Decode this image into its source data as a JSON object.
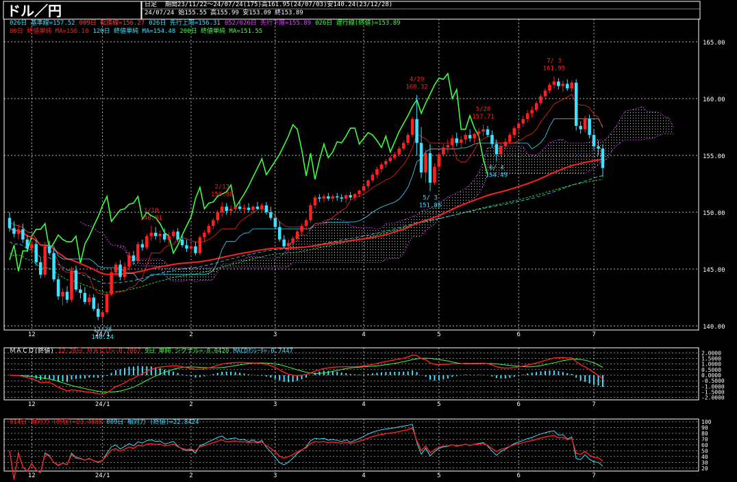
{
  "header": {
    "title": "ドル／円",
    "chart_type_label": "日足",
    "period": "期間23/11/22～24/07/24(175)高161.95(24/07/03)安140.24(23/12/28)",
    "date": "24/07/24",
    "ohlc": "始155.55 高155.99 安153.09 終153.89"
  },
  "indicators": {
    "row1": [
      {
        "text": "026日 基準線=157.52",
        "color": "#40e0ff"
      },
      {
        "text": "009日 転換線=156.27",
        "color": "#ff4040"
      },
      {
        "text": "026日 先行上限=156.31",
        "color": "#40e0ff"
      },
      {
        "text": "052/026日 先行下限=155.89",
        "color": "#e040ff"
      },
      {
        "text": "026日 遅行線(終値)=153.89",
        "color": "#40ff40"
      }
    ],
    "row2": [
      {
        "text": "80日 終値単純 MA=156.10",
        "color": "#ff2020"
      },
      {
        "text": "120日 終値単純 MA=154.48",
        "color": "#40e0ff"
      },
      {
        "text": "200日 終値単純 MA=151.55",
        "color": "#40ff40"
      }
    ]
  },
  "macd_legend": [
    {
      "text": "ＭＡＣＤ(終値)",
      "color": "#ffffff"
    },
    {
      "text": "12-26日 ＭＡＣＤ=-0.7867",
      "color": "#ff2020"
    },
    {
      "text": "9日 単純 シグナル=-0.0420",
      "color": "#40ff40"
    },
    {
      "text": "MACDｵｼﾚｰﾀ=-0.7447",
      "color": "#40e0ff"
    }
  ],
  "rsi_legend": [
    {
      "text": "014日 相対力 (終値)=23.4888",
      "color": "#ff2020"
    },
    {
      "text": "009日 相対力 (終値)=22.8424",
      "color": "#40e0ff"
    }
  ],
  "colors": {
    "up": "#ff2020",
    "down": "#40e0ff",
    "grid": "#ffffff",
    "background": "#000000"
  },
  "chart_data": [
    {
      "type": "candlestick",
      "y_ticks": [
        "140.00",
        "145.00",
        "150.00",
        "155.00",
        "160.00",
        "165.00"
      ],
      "ylim": [
        140,
        166
      ],
      "x_ticks": [
        "12",
        "24/1",
        "2",
        "3",
        "4",
        "5",
        "6",
        "7"
      ],
      "annotations": [
        {
          "label": "12/28",
          "value": "140.24"
        },
        {
          "label": "1/10",
          "value": "148.81"
        },
        {
          "label": "2/13",
          "value": "150.88"
        },
        {
          "label": "4/29",
          "value": "160.32"
        },
        {
          "label": "5/ 3",
          "value": "151.85"
        },
        {
          "label": "5/28",
          "value": "157.71"
        },
        {
          "label": "6/ 4",
          "value": "154.49"
        },
        {
          "label": "7/ 3",
          "value": "161.95"
        }
      ],
      "candles": [
        [
          149.5,
          150.0,
          148.3,
          148.6
        ],
        [
          148.6,
          149.2,
          147.8,
          148.1
        ],
        [
          148.1,
          148.9,
          147.6,
          148.5
        ],
        [
          148.5,
          149.0,
          147.3,
          147.6
        ],
        [
          147.6,
          148.0,
          146.5,
          146.8
        ],
        [
          146.8,
          147.5,
          146.4,
          147.2
        ],
        [
          147.2,
          147.6,
          145.3,
          145.6
        ],
        [
          145.6,
          146.0,
          144.2,
          144.5
        ],
        [
          144.5,
          147.4,
          144.3,
          147.0
        ],
        [
          147.0,
          147.5,
          146.2,
          146.4
        ],
        [
          146.4,
          146.8,
          143.9,
          144.1
        ],
        [
          144.1,
          144.4,
          142.3,
          142.6
        ],
        [
          142.6,
          143.3,
          141.8,
          143.0
        ],
        [
          143.0,
          143.5,
          142.0,
          142.3
        ],
        [
          142.3,
          145.2,
          142.1,
          144.9
        ],
        [
          144.9,
          145.3,
          143.0,
          143.2
        ],
        [
          143.2,
          143.6,
          142.4,
          142.9
        ],
        [
          142.9,
          143.4,
          141.9,
          142.1
        ],
        [
          142.1,
          142.8,
          141.8,
          142.5
        ],
        [
          142.5,
          142.8,
          141.3,
          141.5
        ],
        [
          141.5,
          142.0,
          140.5,
          140.8
        ],
        [
          140.8,
          141.4,
          140.24,
          141.2
        ],
        [
          141.2,
          143.0,
          141.0,
          142.8
        ],
        [
          142.8,
          144.9,
          142.6,
          144.7
        ],
        [
          144.7,
          145.6,
          144.4,
          145.4
        ],
        [
          145.4,
          145.8,
          144.0,
          144.3
        ],
        [
          144.3,
          145.6,
          144.0,
          145.2
        ],
        [
          145.2,
          146.5,
          144.9,
          146.2
        ],
        [
          146.2,
          146.6,
          145.4,
          145.7
        ],
        [
          145.7,
          147.4,
          145.5,
          147.2
        ],
        [
          147.2,
          147.6,
          146.6,
          146.9
        ],
        [
          146.9,
          148.1,
          146.7,
          147.9
        ],
        [
          147.9,
          148.81,
          147.5,
          148.2
        ],
        [
          148.2,
          148.7,
          147.6,
          147.9
        ],
        [
          147.9,
          148.4,
          147.3,
          148.1
        ],
        [
          148.1,
          148.6,
          147.4,
          147.6
        ],
        [
          147.6,
          148.2,
          147.2,
          147.9
        ],
        [
          147.9,
          148.5,
          147.7,
          148.3
        ],
        [
          148.3,
          148.6,
          147.4,
          147.6
        ],
        [
          147.6,
          148.0,
          146.9,
          147.1
        ],
        [
          147.1,
          147.6,
          146.5,
          146.8
        ],
        [
          146.8,
          147.3,
          146.3,
          147.0
        ],
        [
          147.0,
          147.4,
          146.2,
          146.4
        ],
        [
          146.4,
          148.0,
          146.2,
          147.8
        ],
        [
          147.8,
          148.4,
          147.4,
          148.2
        ],
        [
          148.2,
          149.0,
          148.0,
          148.8
        ],
        [
          148.8,
          149.5,
          148.5,
          149.3
        ],
        [
          149.3,
          150.2,
          149.0,
          150.0
        ],
        [
          150.0,
          150.88,
          149.6,
          150.5
        ],
        [
          150.5,
          150.8,
          149.8,
          150.1
        ],
        [
          150.1,
          150.6,
          149.7,
          150.3
        ],
        [
          150.3,
          150.8,
          150.0,
          150.5
        ],
        [
          150.5,
          150.9,
          150.1,
          150.3
        ],
        [
          150.3,
          150.7,
          149.9,
          150.4
        ],
        [
          150.4,
          150.8,
          150.0,
          150.2
        ],
        [
          150.2,
          150.6,
          149.9,
          150.5
        ],
        [
          150.5,
          150.9,
          150.2,
          150.3
        ],
        [
          150.3,
          150.8,
          150.0,
          150.6
        ],
        [
          150.6,
          150.9,
          149.8,
          150.0
        ],
        [
          150.0,
          150.5,
          149.3,
          149.5
        ],
        [
          149.5,
          149.9,
          148.5,
          148.7
        ],
        [
          148.7,
          149.2,
          147.4,
          147.6
        ],
        [
          147.6,
          148.0,
          146.8,
          147.0
        ],
        [
          147.0,
          147.6,
          146.5,
          147.3
        ],
        [
          147.3,
          147.9,
          146.9,
          147.7
        ],
        [
          147.7,
          148.5,
          147.4,
          148.3
        ],
        [
          148.3,
          149.0,
          148.0,
          148.8
        ],
        [
          148.8,
          149.5,
          148.6,
          149.3
        ],
        [
          149.3,
          150.8,
          149.1,
          150.6
        ],
        [
          150.6,
          151.5,
          150.3,
          151.3
        ],
        [
          151.3,
          151.6,
          150.9,
          151.2
        ],
        [
          151.2,
          151.6,
          150.9,
          151.4
        ],
        [
          151.4,
          151.7,
          151.0,
          151.2
        ],
        [
          151.2,
          151.6,
          150.9,
          151.4
        ],
        [
          151.4,
          151.7,
          151.0,
          151.3
        ],
        [
          151.3,
          151.6,
          150.9,
          151.2
        ],
        [
          151.2,
          151.6,
          150.8,
          151.5
        ],
        [
          151.5,
          151.8,
          151.1,
          151.3
        ],
        [
          151.3,
          151.7,
          151.0,
          151.6
        ],
        [
          151.6,
          152.0,
          151.3,
          151.9
        ],
        [
          151.9,
          152.4,
          151.7,
          152.3
        ],
        [
          152.3,
          152.9,
          152.1,
          152.8
        ],
        [
          152.8,
          153.5,
          152.6,
          153.3
        ],
        [
          153.3,
          154.0,
          153.0,
          153.8
        ],
        [
          153.8,
          154.4,
          153.5,
          154.2
        ],
        [
          154.2,
          154.7,
          153.9,
          154.5
        ],
        [
          154.5,
          155.0,
          154.3,
          154.8
        ],
        [
          154.8,
          155.3,
          154.6,
          155.1
        ],
        [
          155.1,
          155.8,
          154.9,
          155.6
        ],
        [
          155.6,
          156.3,
          155.4,
          156.1
        ],
        [
          156.1,
          157.0,
          155.9,
          156.8
        ],
        [
          156.8,
          158.4,
          156.6,
          158.2
        ],
        [
          158.2,
          160.32,
          155.0,
          156.1
        ],
        [
          156.1,
          157.5,
          153.0,
          153.5
        ],
        [
          153.5,
          155.5,
          152.6,
          155.2
        ],
        [
          155.2,
          156.0,
          151.85,
          152.6
        ],
        [
          152.6,
          154.3,
          152.4,
          154.0
        ],
        [
          154.0,
          155.3,
          153.7,
          155.1
        ],
        [
          155.1,
          156.0,
          154.9,
          155.7
        ],
        [
          155.7,
          156.4,
          155.2,
          155.9
        ],
        [
          155.9,
          156.8,
          155.6,
          156.5
        ],
        [
          156.5,
          157.0,
          155.8,
          156.1
        ],
        [
          156.1,
          156.7,
          155.7,
          156.4
        ],
        [
          156.4,
          157.0,
          156.0,
          156.8
        ],
        [
          156.8,
          157.3,
          156.2,
          156.5
        ],
        [
          156.5,
          157.0,
          156.1,
          156.9
        ],
        [
          156.9,
          157.4,
          156.5,
          157.1
        ],
        [
          157.1,
          157.71,
          156.7,
          157.3
        ],
        [
          157.3,
          157.6,
          156.6,
          156.8
        ],
        [
          156.8,
          157.2,
          155.7,
          156.0
        ],
        [
          156.0,
          156.4,
          154.49,
          155.1
        ],
        [
          155.1,
          156.0,
          154.8,
          155.8
        ],
        [
          155.8,
          156.5,
          155.5,
          156.2
        ],
        [
          156.2,
          157.0,
          156.0,
          156.8
        ],
        [
          156.8,
          157.6,
          156.5,
          157.4
        ],
        [
          157.4,
          158.0,
          157.1,
          157.8
        ],
        [
          157.8,
          158.5,
          157.5,
          158.2
        ],
        [
          158.2,
          159.0,
          157.9,
          158.7
        ],
        [
          158.7,
          159.3,
          158.3,
          159.0
        ],
        [
          159.0,
          159.8,
          158.8,
          159.6
        ],
        [
          159.6,
          160.4,
          159.4,
          160.2
        ],
        [
          160.2,
          160.9,
          159.9,
          160.7
        ],
        [
          160.7,
          161.4,
          160.5,
          161.2
        ],
        [
          161.2,
          161.95,
          160.9,
          161.5
        ],
        [
          161.5,
          161.8,
          160.8,
          161.1
        ],
        [
          161.1,
          161.6,
          160.6,
          161.3
        ],
        [
          161.3,
          161.7,
          160.7,
          160.9
        ],
        [
          160.9,
          161.6,
          160.6,
          161.4
        ],
        [
          161.4,
          161.7,
          157.2,
          157.6
        ],
        [
          157.6,
          158.0,
          156.9,
          157.3
        ],
        [
          157.3,
          158.5,
          157.0,
          158.2
        ],
        [
          158.2,
          158.6,
          156.5,
          156.8
        ],
        [
          156.8,
          157.3,
          155.4,
          155.8
        ],
        [
          155.8,
          156.3,
          155.0,
          155.6
        ],
        [
          155.6,
          155.99,
          153.09,
          153.89
        ]
      ]
    },
    {
      "type": "line",
      "name": "MACD",
      "y_ticks": [
        "2.0000",
        "1.5000",
        "1.0000",
        "0.5000",
        "0.0000",
        "-0.5000",
        "-1.0000",
        "-1.5000",
        "-2.0000"
      ],
      "ylim": [
        -2.2,
        2.2
      ]
    },
    {
      "type": "line",
      "name": "RSI",
      "y_ticks": [
        "100",
        "90",
        "80",
        "70",
        "60",
        "50",
        "40",
        "30",
        "20"
      ],
      "ylim": [
        15,
        100
      ]
    }
  ]
}
